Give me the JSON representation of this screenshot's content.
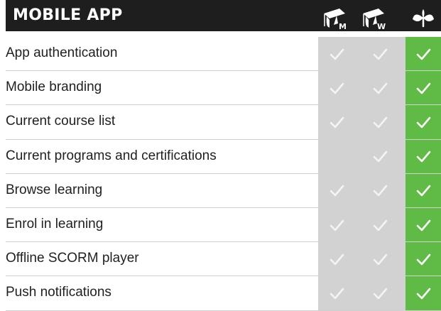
{
  "header": {
    "title": "MOBILE APP",
    "icons": [
      {
        "name": "graduation-cap-m-icon",
        "letter": "M"
      },
      {
        "name": "graduation-cap-w-icon",
        "letter": "W"
      },
      {
        "name": "sprout-icon"
      }
    ]
  },
  "colors": {
    "header_bg": "#1e1e1e",
    "column_gray": "#d2d2d2",
    "column_green": "#5fbb46",
    "check_gray": "#f4f4f4",
    "check_white": "#ffffff"
  },
  "rows": [
    {
      "label": "App authentication",
      "m": true,
      "w": true,
      "p": true
    },
    {
      "label": "Mobile branding",
      "m": true,
      "w": true,
      "p": true
    },
    {
      "label": "Current course list",
      "m": true,
      "w": true,
      "p": true
    },
    {
      "label": "Current programs and certifications",
      "m": false,
      "w": true,
      "p": true
    },
    {
      "label": "Browse learning",
      "m": true,
      "w": true,
      "p": true
    },
    {
      "label": "Enrol in learning",
      "m": true,
      "w": true,
      "p": true
    },
    {
      "label": "Offline SCORM player",
      "m": true,
      "w": true,
      "p": true
    },
    {
      "label": "Push notifications",
      "m": true,
      "w": true,
      "p": true
    }
  ]
}
